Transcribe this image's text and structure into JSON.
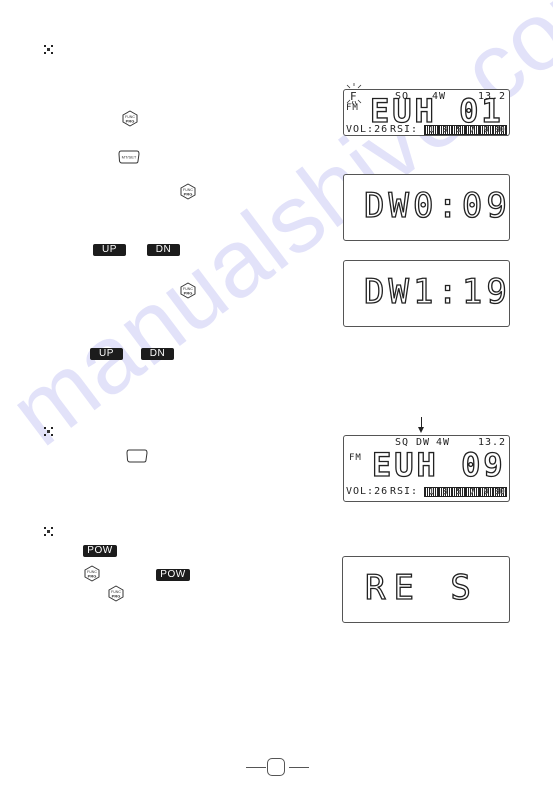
{
  "watermark": "manualshive.com",
  "keys": {
    "func_top": "FUNC",
    "func_bottom": "PRG",
    "mt_set": "MT/SET",
    "up": "UP",
    "dn": "DN",
    "pow": "POW"
  },
  "lcd1": {
    "f_indicator": "F",
    "sq": "SQ",
    "power": "4W",
    "voltage": "13.2",
    "mode": "FM",
    "channel": "EUH 01",
    "vol_label": "VOL:26",
    "rsi_label": "RSI:",
    "rsi_scale": [
      "1",
      "3",
      "5",
      "7",
      "9",
      "30"
    ]
  },
  "lcd2": {
    "text": "DW0:09"
  },
  "lcd3": {
    "text": "DW1:19"
  },
  "lcd4": {
    "sq": "SQ",
    "dw": "DW",
    "power": "4W",
    "voltage": "13.2",
    "mode": "FM",
    "channel": "EUH 09",
    "vol_label": "VOL:26",
    "rsi_label": "RSI:",
    "rsi_scale": [
      "1",
      "3",
      "5",
      "7",
      "9",
      "30"
    ]
  },
  "lcd5": {
    "text": "RE S"
  },
  "page_number": ""
}
